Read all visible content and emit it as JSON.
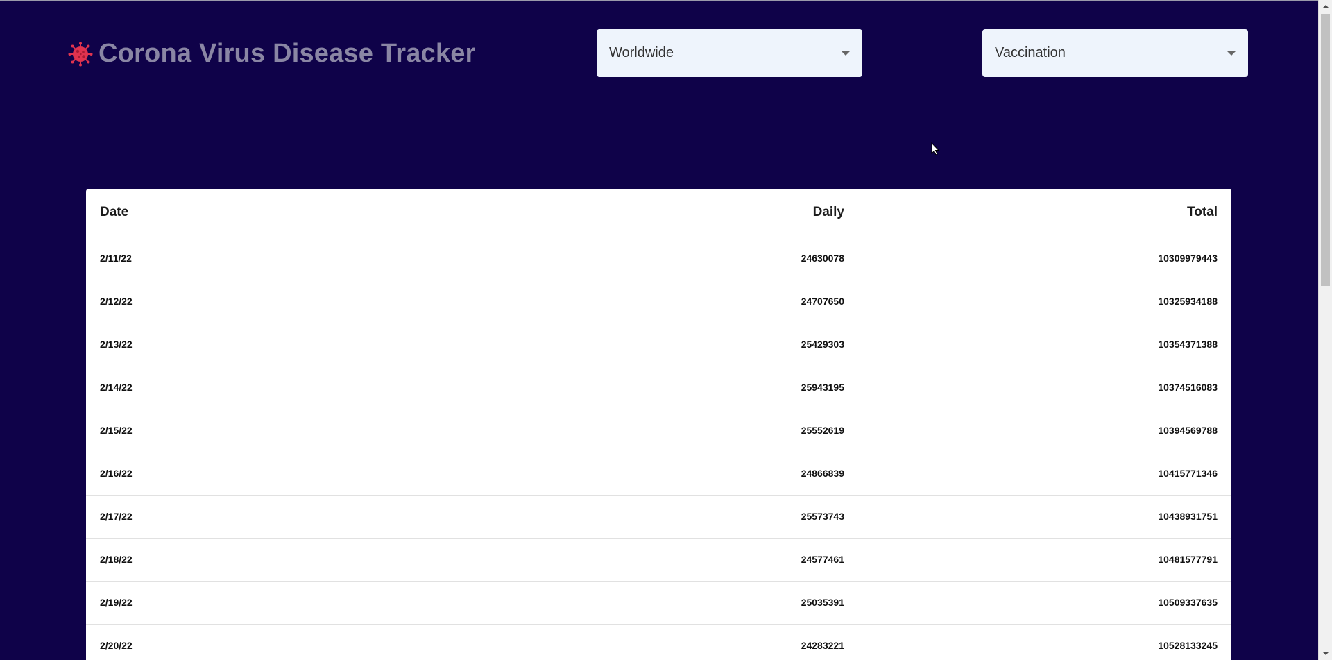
{
  "header": {
    "title": "Corona Virus Disease Tracker",
    "logo_icon": "virus-icon"
  },
  "selects": {
    "country": {
      "value": "Worldwide"
    },
    "metric": {
      "value": "Vaccination"
    }
  },
  "table": {
    "columns": [
      "Date",
      "Daily",
      "Total"
    ],
    "rows": [
      {
        "date": "2/11/22",
        "daily": "24630078",
        "total": "10309979443"
      },
      {
        "date": "2/12/22",
        "daily": "24707650",
        "total": "10325934188"
      },
      {
        "date": "2/13/22",
        "daily": "25429303",
        "total": "10354371388"
      },
      {
        "date": "2/14/22",
        "daily": "25943195",
        "total": "10374516083"
      },
      {
        "date": "2/15/22",
        "daily": "25552619",
        "total": "10394569788"
      },
      {
        "date": "2/16/22",
        "daily": "24866839",
        "total": "10415771346"
      },
      {
        "date": "2/17/22",
        "daily": "25573743",
        "total": "10438931751"
      },
      {
        "date": "2/18/22",
        "daily": "24577461",
        "total": "10481577791"
      },
      {
        "date": "2/19/22",
        "daily": "25035391",
        "total": "10509337635"
      },
      {
        "date": "2/20/22",
        "daily": "24283221",
        "total": "10528133245"
      }
    ]
  },
  "colors": {
    "background": "#0f0249",
    "title": "#8a86a4",
    "select_bg": "#eef4fc",
    "virus": "#e0334f"
  }
}
